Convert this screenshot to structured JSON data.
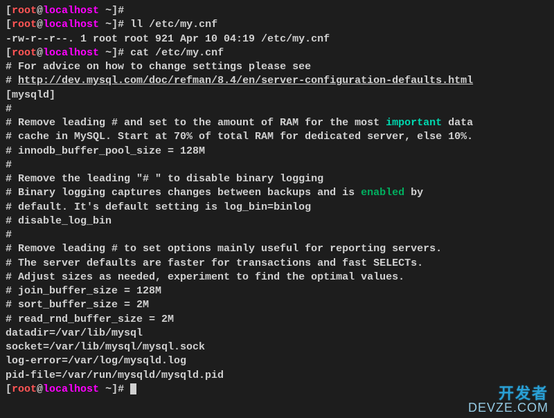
{
  "prompt": {
    "open_bracket": "[",
    "user": "root",
    "at": "@",
    "host": "localhost",
    "space": " ",
    "tilde": "~",
    "close_bracket": "]",
    "hash": "# "
  },
  "cmd1": "",
  "cmd2": "ll /etc/my.cnf",
  "out_ll": "-rw-r--r--. 1 root root 921 Apr 10 04:19 /etc/my.cnf",
  "cmd3": "cat /etc/my.cnf",
  "file": {
    "l1": "# For advice on how to change settings please see",
    "l2_pre": "# ",
    "l2_url": "http://dev.mysql.com/doc/refman/8.4/en/server-configuration-defaults.html",
    "l3": "",
    "l4": "[mysqld]",
    "l5": "#",
    "l6_a": "# Remove leading # and set to the amount of RAM for the most ",
    "l6_kw": "important",
    "l6_b": " data",
    "l7": "# cache in MySQL. Start at 70% of total RAM for dedicated server, else 10%.",
    "l8": "# innodb_buffer_pool_size = 128M",
    "l9": "#",
    "l10": "# Remove the leading \"# \" to disable binary logging",
    "l11_a": "# Binary logging captures changes between backups and is ",
    "l11_kw": "enabled",
    "l11_b": " by",
    "l12": "# default. It's default setting is log_bin=binlog",
    "l13": "# disable_log_bin",
    "l14": "#",
    "l15": "# Remove leading # to set options mainly useful for reporting servers.",
    "l16": "# The server defaults are faster for transactions and fast SELECTs.",
    "l17": "# Adjust sizes as needed, experiment to find the optimal values.",
    "l18": "# join_buffer_size = 128M",
    "l19": "# sort_buffer_size = 2M",
    "l20": "# read_rnd_buffer_size = 2M",
    "l21": "",
    "l22": "datadir=/var/lib/mysql",
    "l23": "socket=/var/lib/mysql/mysql.sock",
    "l24": "",
    "l25": "log-error=/var/log/mysqld.log",
    "l26": "pid-file=/var/run/mysqld/mysqld.pid"
  },
  "watermark": {
    "cn": "开发者",
    "en": "DEVZE.COM"
  }
}
